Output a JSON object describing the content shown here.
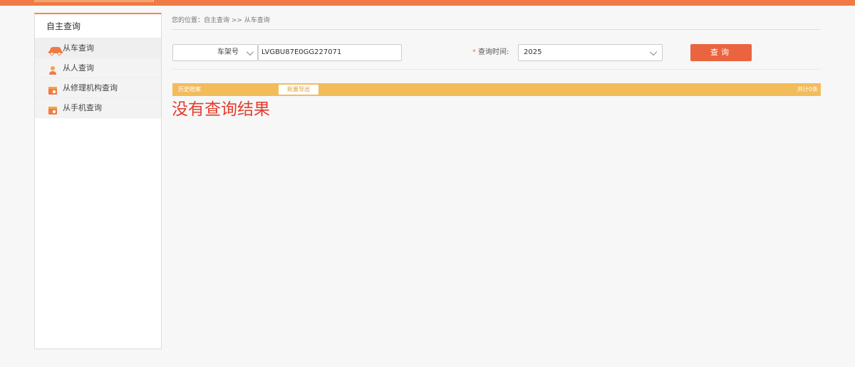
{
  "sidebar": {
    "title": "自主查询",
    "items": [
      {
        "label": "从车查询",
        "icon": "car-icon"
      },
      {
        "label": "从人查询",
        "icon": "person-icon"
      },
      {
        "label": "从修理机构查询",
        "icon": "repair-shop-icon"
      },
      {
        "label": "从手机查询",
        "icon": "phone-icon"
      }
    ]
  },
  "breadcrumb": {
    "text": "您的位置：自主查询 >> 从车查询"
  },
  "query": {
    "type_select": "车架号",
    "vin_value": "LVGBU87E0GG227071",
    "time_label": "查询时间:",
    "required_mark": "*",
    "year_select": "2025",
    "button_label": "查询"
  },
  "history": {
    "label": "历史赔案",
    "export_label": "批量导出",
    "count_text": "共计0条"
  },
  "result": {
    "empty_text": "没有查询结果"
  },
  "colors": {
    "accent": "#ef7a45",
    "button": "#ea6440",
    "history_bar": "#f3bc5b",
    "no_result": "#e33d2e"
  }
}
